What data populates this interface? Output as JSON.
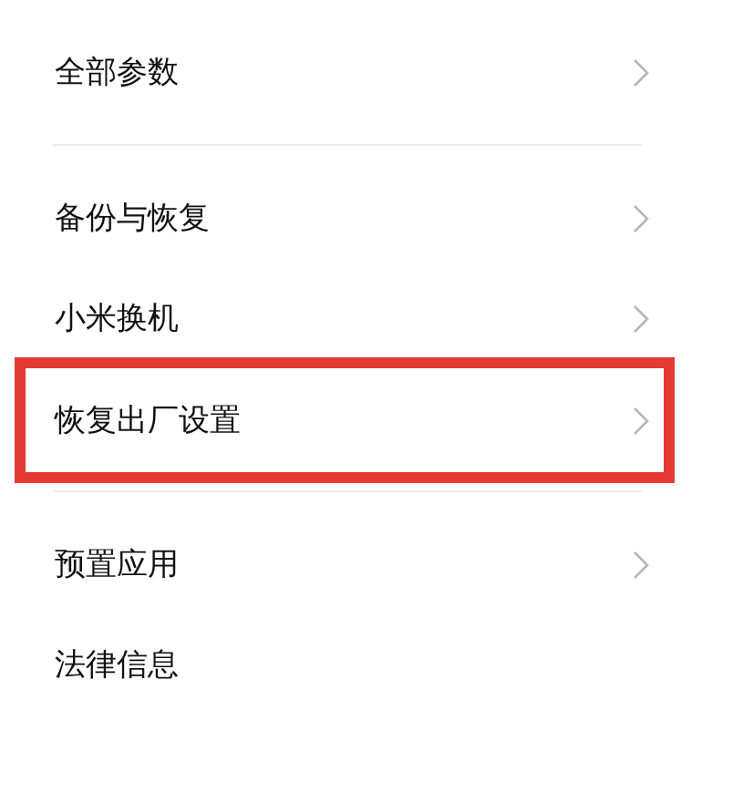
{
  "sections": [
    {
      "items": [
        {
          "label": "全部参数",
          "chevron": true,
          "highlighted": false
        }
      ]
    },
    {
      "items": [
        {
          "label": "备份与恢复",
          "chevron": true,
          "highlighted": false
        },
        {
          "label": "小米换机",
          "chevron": true,
          "highlighted": false
        },
        {
          "label": "恢复出厂设置",
          "chevron": true,
          "highlighted": true
        }
      ]
    },
    {
      "items": [
        {
          "label": "预置应用",
          "chevron": true,
          "highlighted": false
        },
        {
          "label": "法律信息",
          "chevron": false,
          "highlighted": false
        }
      ]
    }
  ]
}
